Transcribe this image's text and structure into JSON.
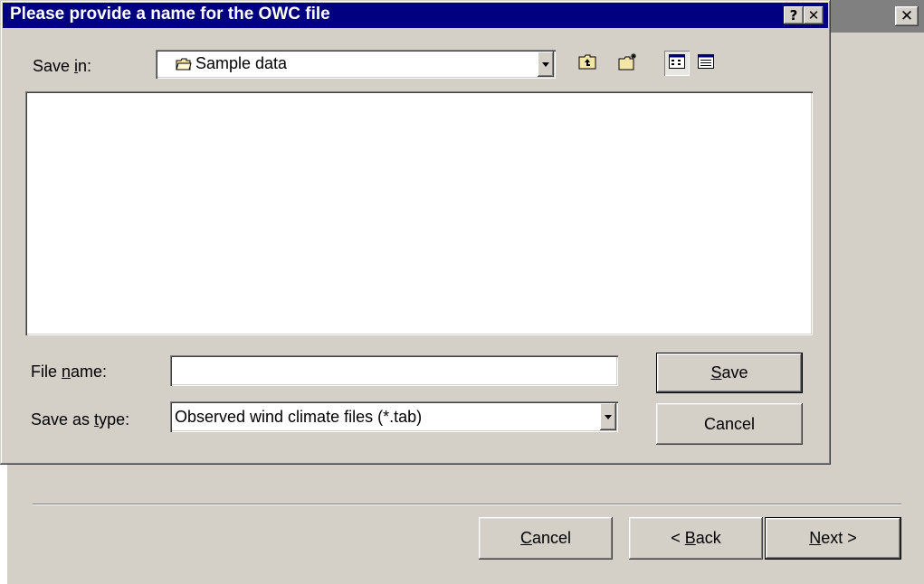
{
  "dialog": {
    "title": "Please provide a name for the OWC file",
    "help_glyph": "?",
    "close_glyph": "✕",
    "save_in": {
      "label_pre": "Save ",
      "label_key": "i",
      "label_post": "n:",
      "value": "Sample data",
      "icon": "folder-icon"
    },
    "toolbar": {
      "icons": [
        "up-one-level-icon",
        "create-new-folder-icon",
        "list-view-icon",
        "details-view-icon"
      ]
    },
    "file_name": {
      "label_pre": "File ",
      "label_key": "n",
      "label_post": "ame:",
      "value": ""
    },
    "save_as_type": {
      "label_pre": "Save as ",
      "label_key": "t",
      "label_post": "ype:",
      "value": "Observed wind climate files (*.tab)"
    },
    "save_button": {
      "key": "S",
      "rest": "ave"
    },
    "cancel_button": "Cancel"
  },
  "wizard": {
    "close_glyph": "✕",
    "cancel": {
      "key": "C",
      "rest": "ancel"
    },
    "back": {
      "pre": "< ",
      "key": "B",
      "rest": "ack"
    },
    "next": {
      "key": "N",
      "rest": "ext >"
    }
  }
}
